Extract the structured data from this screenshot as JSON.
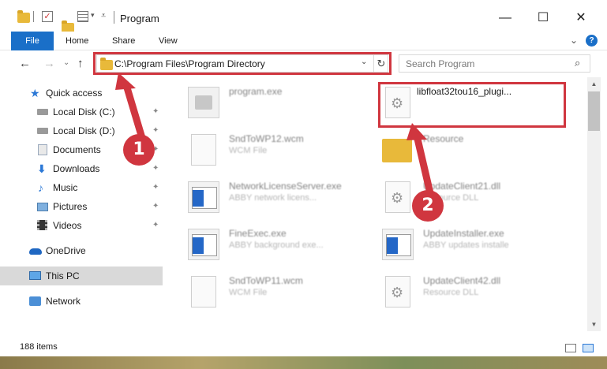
{
  "window": {
    "title": "Program",
    "controls": {
      "minimize": "—",
      "maximize": "☐",
      "close": "✕"
    }
  },
  "ribbon": {
    "tabs": [
      "File",
      "Home",
      "Share",
      "View"
    ],
    "expand_glyph": "⌄",
    "help_glyph": "?"
  },
  "nav": {
    "back": "←",
    "forward": "→",
    "recent": "⌄",
    "up": "↑",
    "address": "C:\\Program Files\\Program Directory",
    "address_dropdown": "⌄",
    "refresh": "↻",
    "search_placeholder": "Search Program",
    "search_icon": "⌕"
  },
  "sidebar": {
    "items": [
      {
        "label": "Quick access",
        "icon": "star-icon",
        "pinned": false
      },
      {
        "label": "Local Disk (C:)",
        "icon": "disk-icon",
        "pinned": true
      },
      {
        "label": "Local Disk (D:)",
        "icon": "disk-icon",
        "pinned": true
      },
      {
        "label": "Documents",
        "icon": "documents-icon",
        "pinned": true
      },
      {
        "label": "Downloads",
        "icon": "downloads-icon",
        "pinned": true
      },
      {
        "label": "Music",
        "icon": "music-icon",
        "pinned": true
      },
      {
        "label": "Pictures",
        "icon": "pictures-icon",
        "pinned": true
      },
      {
        "label": "Videos",
        "icon": "videos-icon",
        "pinned": true
      },
      {
        "label": "OneDrive",
        "icon": "onedrive-icon",
        "pinned": false
      },
      {
        "label": "This PC",
        "icon": "this-pc-icon",
        "pinned": false,
        "selected": true
      },
      {
        "label": "Network",
        "icon": "network-icon",
        "pinned": false
      }
    ],
    "pin_glyph": "📌"
  },
  "files": [
    {
      "name": "program.exe",
      "type": "",
      "icon": "exe-icon"
    },
    {
      "name": "libfloat32tou16_plugi...",
      "type": "",
      "icon": "dll-icon"
    },
    {
      "name": "SndToWP12.wcm",
      "type": "WCM File",
      "icon": "blank-file-icon"
    },
    {
      "name": "Resource",
      "type": "",
      "icon": "folder-icon"
    },
    {
      "name": "NetworkLicenseServer.exe",
      "type": "ABBY network licens...",
      "icon": "window-exe-icon"
    },
    {
      "name": "UpdateClient21.dll",
      "type": "Resource DLL",
      "icon": "dll-icon"
    },
    {
      "name": "FineExec.exe",
      "type": "ABBY background exe...",
      "icon": "window-exe-icon"
    },
    {
      "name": "UpdateInstaller.exe",
      "type": "ABBY updates installe",
      "icon": "window-exe-icon"
    },
    {
      "name": "SndToWP11.wcm",
      "type": "WCM File",
      "icon": "blank-file-icon"
    },
    {
      "name": "UpdateClient42.dll",
      "type": "Resource DLL",
      "icon": "dll-icon"
    }
  ],
  "status": {
    "items_count": "188 items"
  },
  "annotations": {
    "badge_1": "1",
    "badge_2": "2",
    "accent": "#d0363f"
  },
  "scrollbar": {
    "up": "▲",
    "down": "▼"
  }
}
